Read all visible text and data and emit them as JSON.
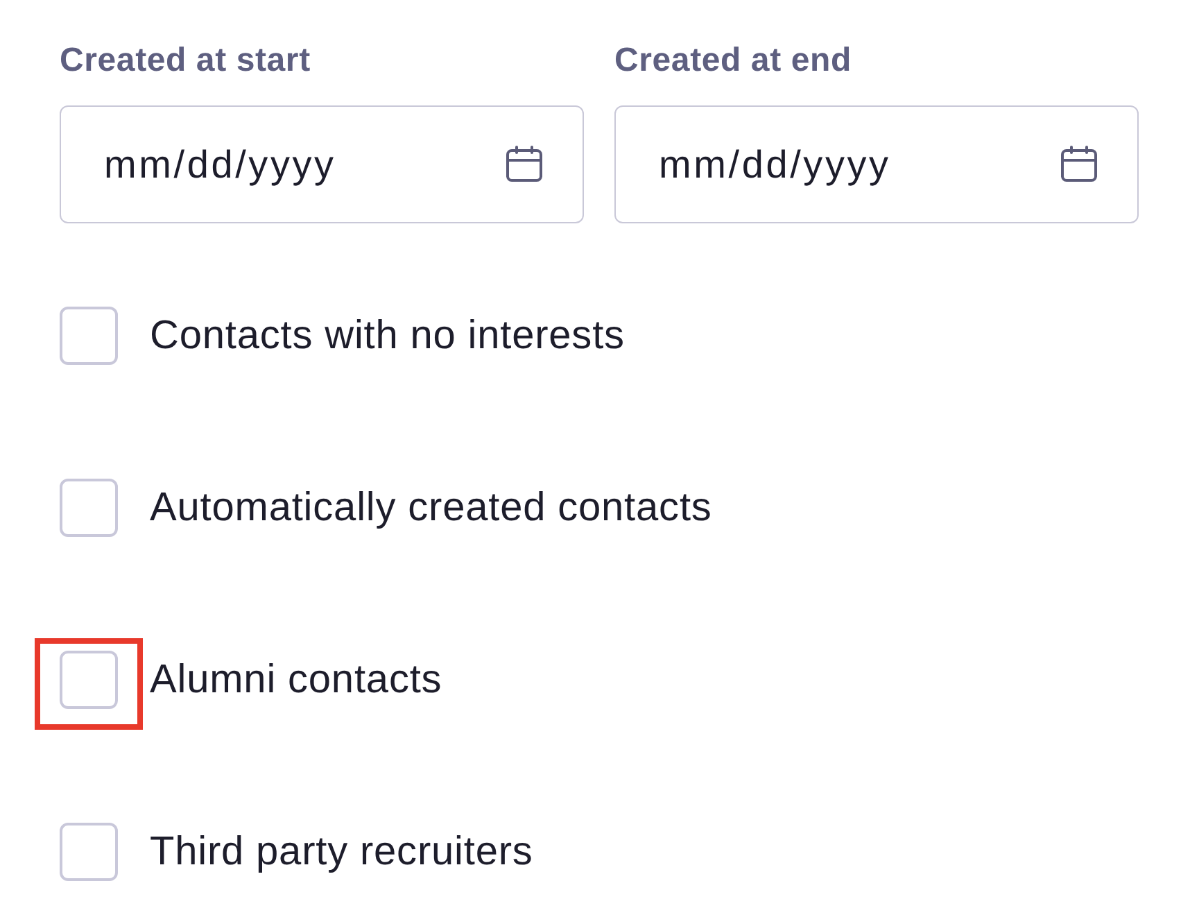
{
  "date_fields": [
    {
      "label": "Created at start",
      "placeholder": "mm/dd/yyyy"
    },
    {
      "label": "Created at end",
      "placeholder": "mm/dd/yyyy"
    }
  ],
  "checkboxes": [
    {
      "label": "Contacts with no interests",
      "checked": false,
      "highlighted": false
    },
    {
      "label": "Automatically created contacts",
      "checked": false,
      "highlighted": false
    },
    {
      "label": "Alumni contacts",
      "checked": false,
      "highlighted": true
    },
    {
      "label": "Third party recruiters",
      "checked": false,
      "highlighted": false
    }
  ]
}
